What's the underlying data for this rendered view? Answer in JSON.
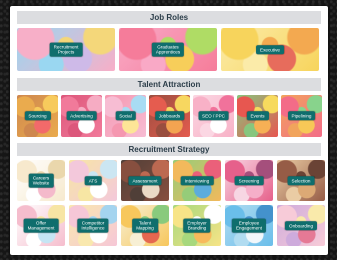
{
  "sections": {
    "job_roles": {
      "title": "Job Roles",
      "tiles": [
        {
          "label": "Recruitment\nProjects",
          "colors": [
            "#f7a6c2",
            "#c9b3e6",
            "#f3d36b",
            "#8fd3f0"
          ]
        },
        {
          "label": "Graduates\nApprentices",
          "colors": [
            "#f46e8f",
            "#f7c948",
            "#a6d854",
            "#f9a0c0"
          ]
        },
        {
          "label": "Executive",
          "colors": [
            "#f7d04a",
            "#e55c4a",
            "#f2a03d",
            "#fbe9a0"
          ]
        }
      ]
    },
    "talent_attraction": {
      "title": "Talent Attraction",
      "tiles": [
        {
          "label": "Sourcing",
          "colors": [
            "#e8a23a",
            "#f15a5a",
            "#f7c54a",
            "#c97a3a"
          ]
        },
        {
          "label": "Advertising",
          "colors": [
            "#f06b8f",
            "#ffffff",
            "#f5a3bd",
            "#d9446c"
          ]
        },
        {
          "label": "Social",
          "colors": [
            "#f7b6cf",
            "#fde38c",
            "#9fd8f2",
            "#f48ca8"
          ]
        },
        {
          "label": "Jobboards",
          "colors": [
            "#e24a3b",
            "#f29a3e",
            "#f7d34f",
            "#8e3a2a"
          ]
        },
        {
          "label": "SEO / PPC",
          "colors": [
            "#f8a9c1",
            "#ffffff",
            "#f06290",
            "#fbd3e0"
          ]
        },
        {
          "label": "Events",
          "colors": [
            "#e5443d",
            "#f5a742",
            "#f7d64c",
            "#7ac070"
          ]
        },
        {
          "label": "Pipelining",
          "colors": [
            "#f25c7b",
            "#f7c245",
            "#7bcf7f",
            "#f09a4a"
          ]
        }
      ]
    },
    "recruitment_strategy": {
      "title": "Recruitment Strategy",
      "tiles": [
        {
          "label": "Careers\nWebsite",
          "colors": [
            "#f6e7c8",
            "#f3b3c6",
            "#e8d3a3",
            "#ffffff"
          ]
        },
        {
          "label": "ATS",
          "colors": [
            "#f2c2d7",
            "#ffffff",
            "#c6e4f1",
            "#f7e49a"
          ]
        },
        {
          "label": "Assessment",
          "colors": [
            "#7a3b2a",
            "#e9d6c0",
            "#b5583e",
            "#3d2a22"
          ]
        },
        {
          "label": "Interviewing",
          "colors": [
            "#f1b24a",
            "#4aa3d9",
            "#e94e6b",
            "#8ac76a"
          ]
        },
        {
          "label": "Screening",
          "colors": [
            "#e44f7e",
            "#f4a6c3",
            "#9b3b6e",
            "#f7d2e0"
          ]
        },
        {
          "label": "Selection",
          "colors": [
            "#8b4a32",
            "#d9a066",
            "#5a2e1f",
            "#e8c79a"
          ]
        },
        {
          "label": "Offer\nManagement",
          "colors": [
            "#f4b6c8",
            "#bfe3f3",
            "#f7e39a",
            "#ffffff"
          ]
        },
        {
          "label": "Competitor\nIntelligence",
          "colors": [
            "#f5c1d3",
            "#ffffff",
            "#9ad0ee",
            "#f9e6a5"
          ]
        },
        {
          "label": "Talent\nMapping",
          "colors": [
            "#f7c14a",
            "#e2563d",
            "#7cc46f",
            "#f7eed0"
          ]
        },
        {
          "label": "Employer\nBranding",
          "colors": [
            "#f6e17a",
            "#f7b34a",
            "#ffffff",
            "#9dd46f"
          ]
        },
        {
          "label": "Employee\nEngagement",
          "colors": [
            "#5ab7e8",
            "#f0f6fb",
            "#2f86c7",
            "#a9d8f0"
          ]
        },
        {
          "label": "Onboarding",
          "colors": [
            "#f7c6d4",
            "#e26a8a",
            "#f9e8a2",
            "#c9a2d8"
          ]
        }
      ]
    }
  }
}
